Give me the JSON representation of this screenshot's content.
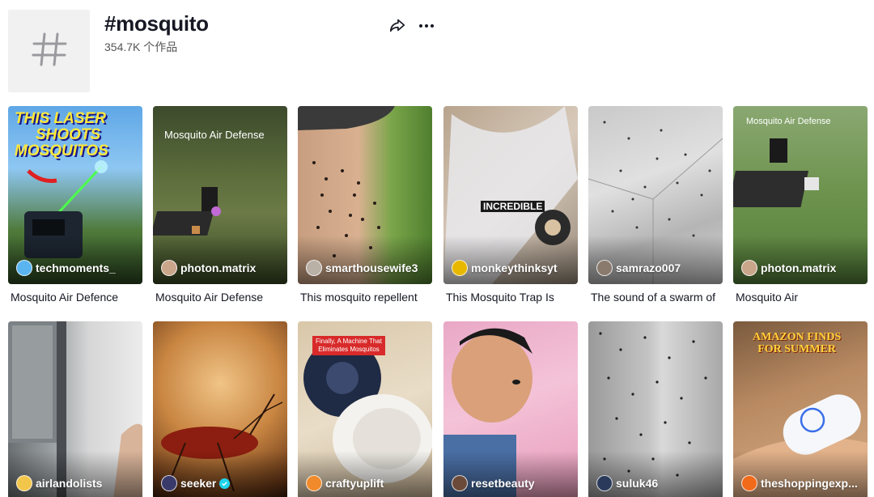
{
  "hashtag": {
    "title": "#mosquito",
    "count_label": "354.7K 个作品",
    "avatar_icon": "hashtag-icon",
    "share_icon": "share-icon",
    "more_icon": "more-horizontal-icon"
  },
  "videos": [
    {
      "author": "techmoments_",
      "caption": "Mosquito Air Defence",
      "overlay_lines": [
        "THIS LASER",
        "SHOOTS",
        "MOSQUITOS"
      ]
    },
    {
      "author": "photon.matrix",
      "caption": "Mosquito Air Defense",
      "overlay_lines": [
        "Mosquito Air Defense"
      ]
    },
    {
      "author": "smarthousewife3",
      "caption": "This mosquito repellent"
    },
    {
      "author": "monkeythinksyt",
      "caption": "This Mosquito Trap Is",
      "overlay_lines": [
        "INCREDIBLE"
      ]
    },
    {
      "author": "samrazo007",
      "caption": "The sound of a swarm of"
    },
    {
      "author": "photon.matrix",
      "caption": "Mosquito Air",
      "overlay_lines": [
        "Mosquito Air Defense"
      ]
    },
    {
      "author": "airlandolists",
      "caption": ""
    },
    {
      "author": "seeker",
      "caption": "",
      "verified": true
    },
    {
      "author": "craftyuplift",
      "caption": "",
      "overlay_lines": [
        "Finally, A Machine That",
        "Eliminates Mosquitos"
      ]
    },
    {
      "author": "resetbeauty",
      "caption": ""
    },
    {
      "author": "suluk46",
      "caption": ""
    },
    {
      "author": "theshoppingexp...",
      "caption": "",
      "overlay_lines": [
        "AMAZON FINDS",
        "FOR SUMMER"
      ]
    }
  ]
}
